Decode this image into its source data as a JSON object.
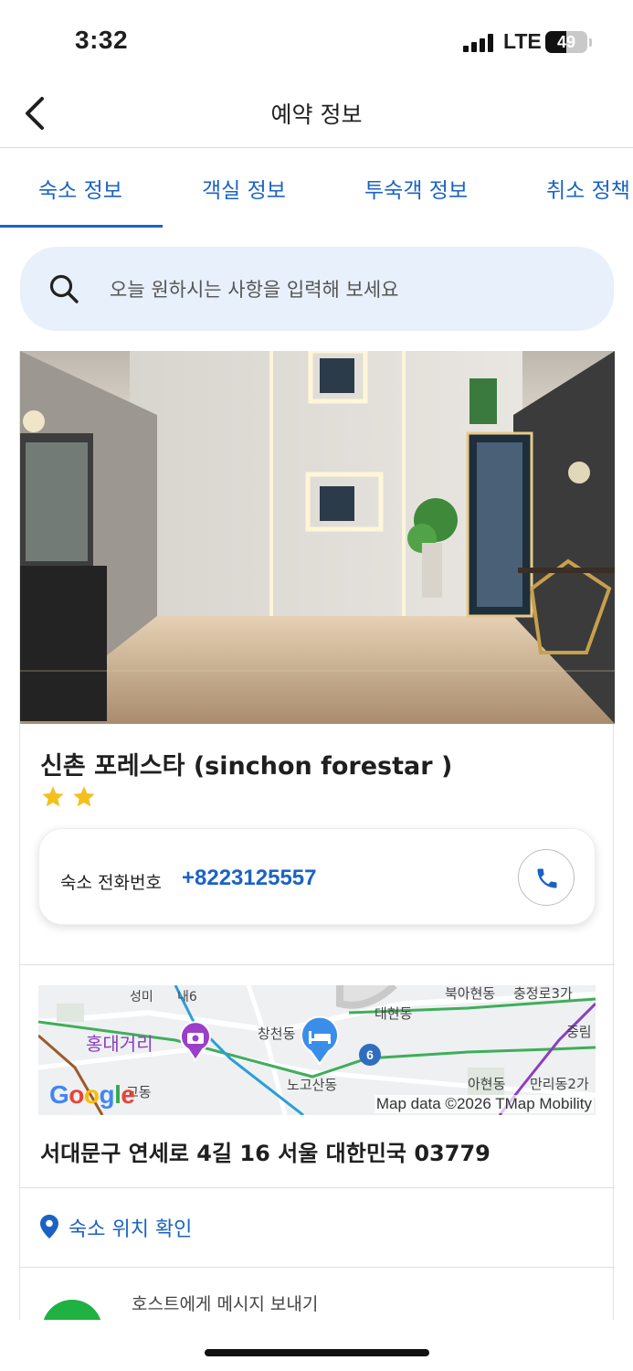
{
  "status_bar": {
    "time": "3:32",
    "network": "LTE",
    "battery": "49",
    "battery_level": 0.49
  },
  "header": {
    "title": "예약 정보",
    "back_icon": "chevron-left-icon"
  },
  "tabs": [
    {
      "label": "숙소 정보",
      "selected": true
    },
    {
      "label": "객실 정보",
      "selected": false
    },
    {
      "label": "투숙객 정보",
      "selected": false
    },
    {
      "label": "취소 정책",
      "selected": false
    }
  ],
  "search": {
    "placeholder": "오늘 원하시는 사항을 입력해 보세요",
    "icon": "search-icon"
  },
  "property": {
    "name": "신촌 포레스타 (sinchon forestar )",
    "star_rating": 2,
    "phone_label": "숙소 전화번호",
    "phone_number": "+8223125557",
    "address": "서대문구 연세로 4길 16 서울 대한민국 03779",
    "location_link": "숙소 위치 확인",
    "host_message": "호스트에게 메시지 보내기"
  },
  "map": {
    "attribution": "Map data ©2026 TMap Mobility",
    "logo": "Google",
    "route_badge": "6",
    "labels": {
      "hongdae": "홍대거리",
      "changcheon": "창천동",
      "daehyeon": "대현동",
      "nogosan": "노고산동",
      "ahyeon": "아현동",
      "malli": "만리동2가",
      "jungnim": "중림",
      "chungjeong": "충정로3가",
      "bugahyeon": "북아현동",
      "seonggyo": "성미",
      "dong_left": "교동",
      "top_left": "내6"
    },
    "colors": {
      "road_green": "#3fae5a",
      "road_blue": "#2a9fd6",
      "road_purple": "#8b3fbf",
      "road_brown": "#9c5a2a"
    }
  },
  "colors": {
    "accent": "#1a63c4",
    "search_bg": "#e8f0fb",
    "star": "#f4c01e",
    "host_avatar": "#1fb141"
  }
}
